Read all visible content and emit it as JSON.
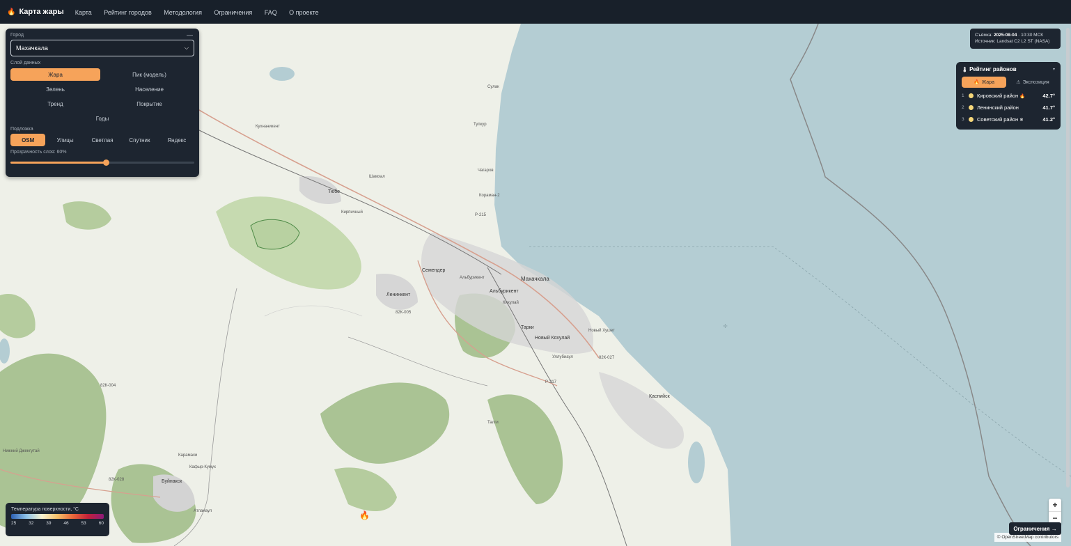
{
  "nav": {
    "brand": "Карта жары",
    "links": [
      "Карта",
      "Рейтинг городов",
      "Методология",
      "Ограничения",
      "FAQ",
      "О проекте"
    ]
  },
  "panel": {
    "city_label": "Город",
    "city_value": "Махачкала",
    "layers_label": "Слой данных",
    "layers": [
      "Жара",
      "Пик (модель)",
      "Зелень",
      "Население",
      "Тренд",
      "Покрытие",
      "Годы"
    ],
    "active_layer": "Жара",
    "basemap_label": "Подложка",
    "basemaps": [
      "OSM",
      "Улицы",
      "Светлая",
      "Спутник",
      "Яндекс"
    ],
    "active_basemap": "OSM",
    "opacity_label": "Прозрачность слоя: 60%",
    "opacity_fraction": 0.52
  },
  "info": {
    "shot_label": "Съёмка:",
    "shot_date": "2025-08-04",
    "shot_time": "· 10:30 МСК",
    "source": "Источник: Landsat C2 L2 ST (NASA)"
  },
  "ranking": {
    "title": "Рейтинг районов",
    "tabs": [
      "Жара",
      "Экспозиция"
    ],
    "rows": [
      {
        "rank": "1",
        "name": "Кировский район",
        "mark": "🔥",
        "value": "42.7°"
      },
      {
        "rank": "2",
        "name": "Ленинский район",
        "mark": "",
        "value": "41.7°"
      },
      {
        "rank": "3",
        "name": "Советский район",
        "mark": "❄",
        "value": "41.2°"
      }
    ]
  },
  "legend": {
    "title": "Температура поверхности, °C",
    "ticks": [
      "25",
      "32",
      "39",
      "46",
      "53",
      "60"
    ]
  },
  "map": {
    "labels": [
      "Махачкала",
      "Каспийск",
      "Буйнакск",
      "Семендер",
      "Ленинкент",
      "Альбурикент",
      "Тарки",
      "Новый Хушет",
      "Новый Кяхулай",
      "Кяхулай",
      "Тюбе",
      "Шамхал",
      "Сулак",
      "Тупкур",
      "Чагаров",
      "Кораман-2",
      "Кухнаникент",
      "Уллубиаул",
      "Атланаул",
      "Кафыр-Кумух",
      "Карамахи",
      "Кирпичный",
      "Альбурикент",
      "Р-217",
      "Р-215",
      "82К-005",
      "82К-004",
      "82К-028",
      "82К-027",
      "Нижний Дженгутай",
      "Талги"
    ],
    "attribution": "© OpenStreetMap contributors",
    "limits_button": "Ограничения →"
  },
  "colors": {
    "accent": "#f6a35a",
    "panel_bg": "#1d2530",
    "sea": "#b4cdd3",
    "land": "#eef0e8",
    "forest": "#a9c293"
  }
}
